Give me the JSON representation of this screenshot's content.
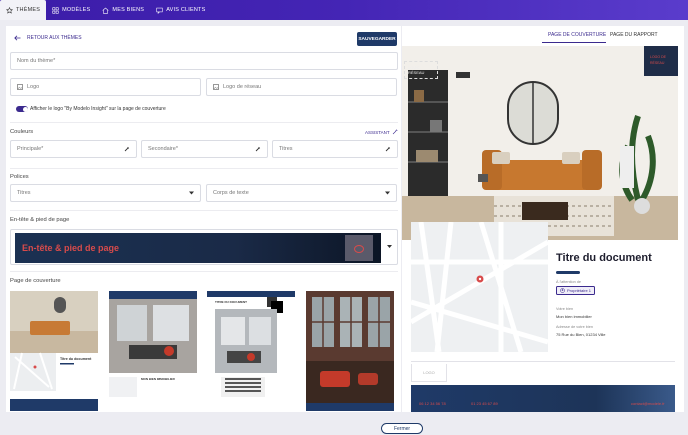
{
  "nav": {
    "tabs": [
      {
        "label": "THÈMES",
        "icon": "star-icon"
      },
      {
        "label": "MODÈLES",
        "icon": "grid-icon"
      },
      {
        "label": "MES BIENS",
        "icon": "home-icon"
      },
      {
        "label": "AVIS CLIENTS",
        "icon": "chat-icon"
      }
    ]
  },
  "editor": {
    "back_label": "RETOUR AUX THÈMES",
    "save_label": "SAUVEGARDER",
    "theme_name_placeholder": "Nom du thème*",
    "logo_label": "Logo",
    "network_logo_label": "Logo de réseau",
    "toggle_label": "Afficher le logo \"By Modelo Insight\" sur la page de couverture",
    "toggle_on": true,
    "colors_title": "Couleurs",
    "assistant_label": "ASSISTANT",
    "color_fields": [
      "Principale*",
      "Secondaire*",
      "Titres"
    ],
    "fonts_title": "Polices",
    "font_fields": [
      "Titres",
      "Corps de texte"
    ],
    "header_footer_title": "En-tête & pied de page",
    "header_footer_sample": "En-tête & pied de page",
    "cover_title": "Page de couverture",
    "cover_thumb_texts": [
      "Titre du document",
      "MON BIEN IMMOBILIER",
      "TITRE DU DOCUMENT"
    ]
  },
  "preview": {
    "tabs": [
      "PAGE DE COUVERTURE",
      "PAGE DU RAPPORT"
    ],
    "logo_placeholder": "LOGO RÉSEAU",
    "badge_line1": "LOGO DE",
    "badge_line2": "RÉSEAU",
    "doc_title": "Titre du document",
    "attention_label": "À l'attention de",
    "owner": "Propriétaire 1",
    "bien_label": "Votre bien",
    "bien_value": "Mon bien immobilier",
    "address_label": "Adresse de votre bien",
    "address_value": "75 Rue du Bien, 01234 Ville",
    "logo_box": "LOGO",
    "footer_items": [
      "06 12 34 56 78",
      "01 23 45 67 89",
      "contact@modele.fr"
    ]
  },
  "footer": {
    "close_label": "Fermer"
  },
  "colors": {
    "accent": "#3b2a8e",
    "navy": "#1f3a68",
    "red": "#d84b4b"
  }
}
